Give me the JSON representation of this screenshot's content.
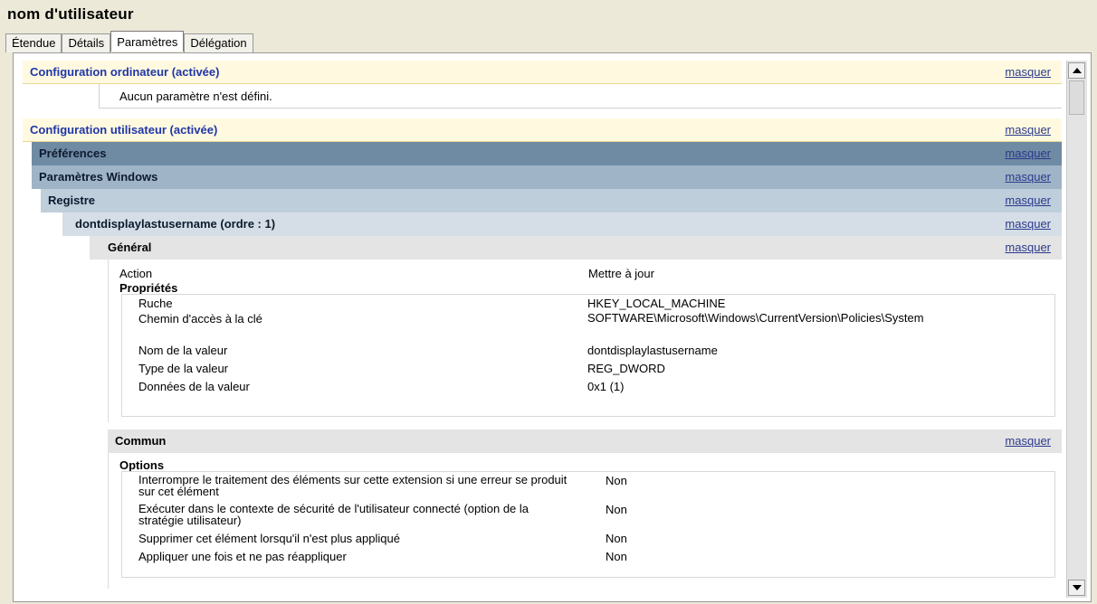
{
  "window_title": "nom d'utilisateur",
  "tabs": [
    {
      "label": "Étendue"
    },
    {
      "label": "Détails"
    },
    {
      "label": "Paramètres"
    },
    {
      "label": "Délégation"
    }
  ],
  "hide_label": "masquer",
  "computer_config": {
    "title": "Configuration ordinateur (activée)",
    "empty_text": "Aucun paramètre n'est défini."
  },
  "user_config": {
    "title": "Configuration utilisateur (activée)"
  },
  "preferences": {
    "title": "Préférences"
  },
  "windows_settings": {
    "title": "Paramètres Windows"
  },
  "registry": {
    "title": "Registre"
  },
  "item": {
    "title": "dontdisplaylastusername (ordre : 1)"
  },
  "general": {
    "title": "Général",
    "action_label": "Action",
    "action_value": "Mettre à jour",
    "properties_label": "Propriétés",
    "properties": [
      {
        "label": "Ruche",
        "value": "HKEY_LOCAL_MACHINE"
      },
      {
        "label": "Chemin d'accès à la clé",
        "value": "SOFTWARE\\Microsoft\\Windows\\CurrentVersion\\Policies\\System"
      },
      {
        "label": "Nom de la valeur",
        "value": "dontdisplaylastusername"
      },
      {
        "label": "Type de la valeur",
        "value": "REG_DWORD"
      },
      {
        "label": "Données de la valeur",
        "value": "0x1 (1)"
      }
    ]
  },
  "common": {
    "title": "Commun",
    "options_label": "Options",
    "options": [
      {
        "label": "Interrompre le traitement des éléments sur cette extension si une erreur se produit sur cet élément",
        "value": "Non"
      },
      {
        "label": "Exécuter dans le contexte de sécurité de l'utilisateur connecté (option de la stratégie utilisateur)",
        "value": "Non"
      },
      {
        "label": "Supprimer cet élément lorsqu'il n'est plus appliqué",
        "value": "Non"
      },
      {
        "label": "Appliquer une fois et ne pas réappliquer",
        "value": "Non"
      }
    ]
  }
}
